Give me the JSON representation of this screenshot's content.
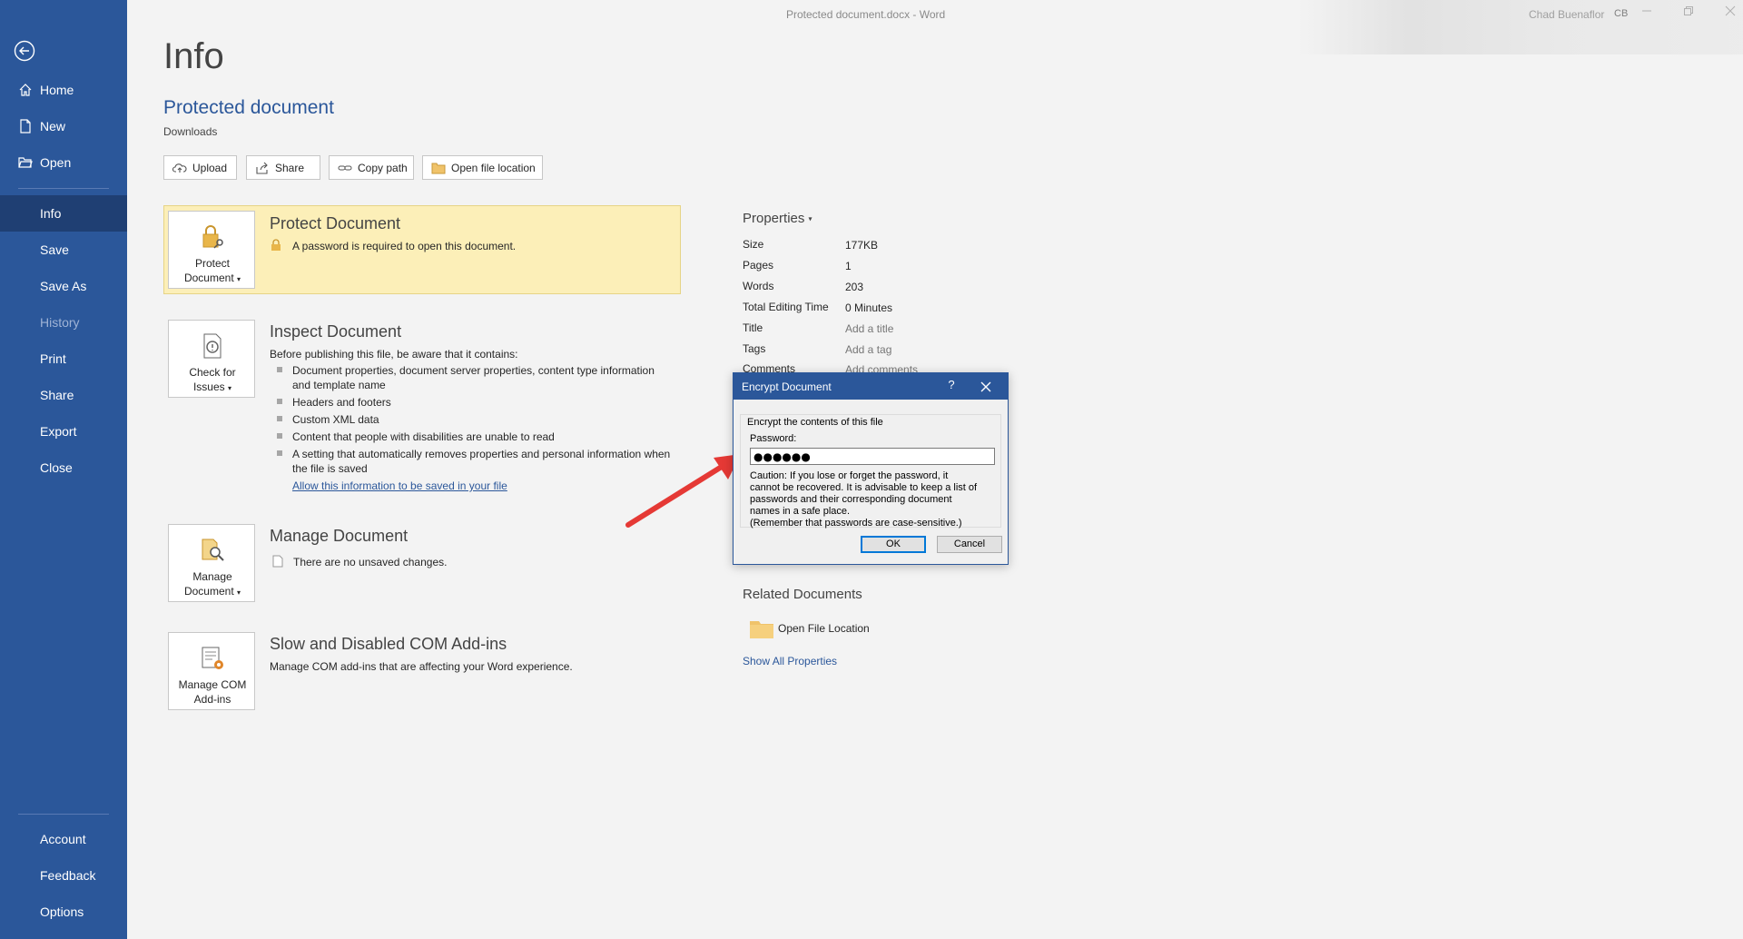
{
  "window": {
    "title": "Protected document.docx  -  Word",
    "user_name": "Chad Buenaflor",
    "user_initials": "CB"
  },
  "sidebar": {
    "items": [
      {
        "label": "Home",
        "icon": "home-icon"
      },
      {
        "label": "New",
        "icon": "new-document-icon"
      },
      {
        "label": "Open",
        "icon": "open-folder-icon"
      },
      {
        "label": "Info"
      },
      {
        "label": "Save"
      },
      {
        "label": "Save As"
      },
      {
        "label": "History"
      },
      {
        "label": "Print"
      },
      {
        "label": "Share"
      },
      {
        "label": "Export"
      },
      {
        "label": "Close"
      },
      {
        "label": "Account"
      },
      {
        "label": "Feedback"
      },
      {
        "label": "Options"
      }
    ]
  },
  "info": {
    "title": "Info",
    "doc_name": "Protected document",
    "doc_path": "Downloads",
    "actions": [
      {
        "label": "Upload",
        "icon": "upload-icon"
      },
      {
        "label": "Share",
        "icon": "share-icon"
      },
      {
        "label": "Copy path",
        "icon": "link-icon"
      },
      {
        "label": "Open file location",
        "icon": "folder-icon"
      }
    ]
  },
  "protect": {
    "button_line1": "Protect",
    "button_line2": "Document",
    "title": "Protect Document",
    "text": "A password is required to open this document."
  },
  "inspect": {
    "button_line1": "Check for",
    "button_line2": "Issues",
    "title": "Inspect Document",
    "intro": "Before publishing this file, be aware that it contains:",
    "bullets": [
      {
        "line1": "Document properties, document server properties, content type information",
        "line2": "and template name"
      },
      {
        "line1": "Headers and footers"
      },
      {
        "line1": "Custom XML data"
      },
      {
        "line1": "Content that people with disabilities are unable to read"
      },
      {
        "line1": "A setting that automatically removes properties and personal information when",
        "line2": "the file is saved"
      }
    ],
    "link": "Allow this information to be saved in your file"
  },
  "manage": {
    "button_line1": "Manage",
    "button_line2": "Document",
    "title": "Manage Document",
    "text": "There are no unsaved changes."
  },
  "addins": {
    "button_line1": "Manage COM",
    "button_line2": "Add-ins",
    "title": "Slow and Disabled COM Add-ins",
    "text": "Manage COM add-ins that are affecting your Word experience."
  },
  "properties": {
    "header": "Properties",
    "rows": [
      {
        "key": "Size",
        "value": "177KB"
      },
      {
        "key": "Pages",
        "value": "1"
      },
      {
        "key": "Words",
        "value": "203"
      },
      {
        "key": "Total Editing Time",
        "value": "0 Minutes"
      },
      {
        "key": "Title",
        "value": "Add a title"
      },
      {
        "key": "Tags",
        "value": "Add a tag"
      },
      {
        "key": "Comments",
        "value": "Add comments"
      }
    ]
  },
  "related": {
    "header": "Related Documents",
    "open_location": "Open File Location",
    "show_all": "Show All Properties"
  },
  "dialog": {
    "title": "Encrypt Document",
    "help": "?",
    "group_label": "Encrypt the contents of this file",
    "password_label": "Password:",
    "password_value": "●●●●●●",
    "caution_lines": [
      "Caution: If you lose or forget the password, it",
      "cannot be recovered. It is advisable to keep a list of",
      "passwords and their corresponding document",
      "names in a safe place.",
      "(Remember that passwords are case-sensitive.)"
    ],
    "ok": "OK",
    "cancel": "Cancel"
  },
  "colors": {
    "accent": "#2b579a",
    "protect_highlight": "#fcefb8",
    "arrow": "#e53935"
  }
}
